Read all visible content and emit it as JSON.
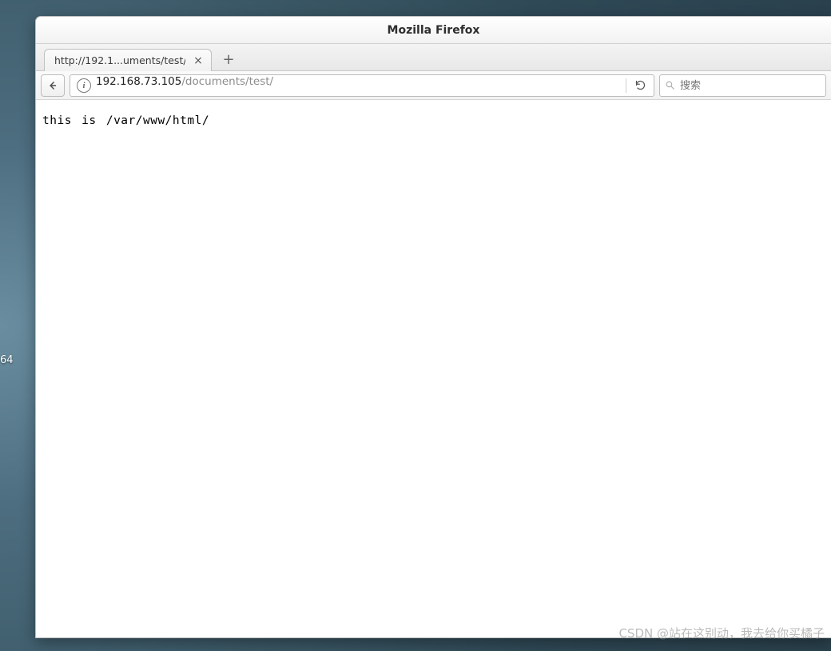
{
  "desktop": {
    "side_label": "64"
  },
  "window": {
    "title": "Mozilla Firefox"
  },
  "tabs": [
    {
      "title": "http://192.1...uments/test/"
    }
  ],
  "address": {
    "host": "192.168.73.105",
    "path": "/documents/test/"
  },
  "search": {
    "placeholder": "搜索"
  },
  "page": {
    "body_text": "this is /var/www/html/"
  },
  "watermark": "CSDN @站在这别动，我去给你买橘子"
}
